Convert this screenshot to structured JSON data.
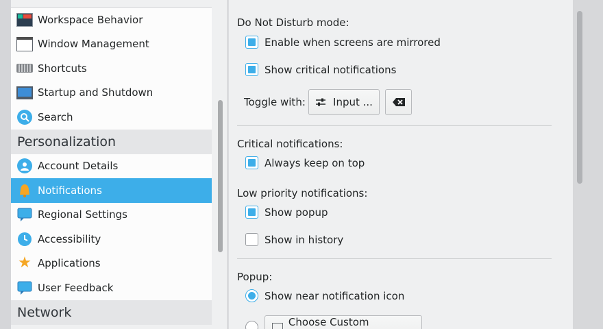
{
  "sidebar": {
    "items_top": [
      {
        "label": "Workspace Behavior",
        "icon": "workspace-icon"
      },
      {
        "label": "Window Management",
        "icon": "window-icon"
      },
      {
        "label": "Shortcuts",
        "icon": "keyboard-icon"
      },
      {
        "label": "Startup and Shutdown",
        "icon": "monitor-icon"
      },
      {
        "label": "Search",
        "icon": "search-icon"
      }
    ],
    "section_personalization": "Personalization",
    "items_personalization": [
      {
        "label": "Account Details",
        "icon": "user-icon"
      },
      {
        "label": "Notifications",
        "icon": "bell-icon"
      },
      {
        "label": "Regional Settings",
        "icon": "chat-icon"
      },
      {
        "label": "Accessibility",
        "icon": "clock-icon"
      },
      {
        "label": "Applications",
        "icon": "star-icon"
      },
      {
        "label": "User Feedback",
        "icon": "chat-icon"
      }
    ],
    "section_network": "Network"
  },
  "main": {
    "dnd_label": "Do Not Disturb mode:",
    "dnd_mirrored": "Enable when screens are mirrored",
    "dnd_critical": "Show critical notifications",
    "toggle_label": "Toggle with:",
    "input_button": "Input ...",
    "critical_label": "Critical notifications:",
    "critical_keep_on_top": "Always keep on top",
    "low_label": "Low priority notifications:",
    "low_show_popup": "Show popup",
    "low_show_history": "Show in history",
    "popup_label": "Popup:",
    "popup_near_icon": "Show near notification icon",
    "popup_custom": "Choose Custom Position..."
  },
  "colors": {
    "accent": "#3daee9",
    "background": "#eff0f1",
    "text": "#232627"
  }
}
